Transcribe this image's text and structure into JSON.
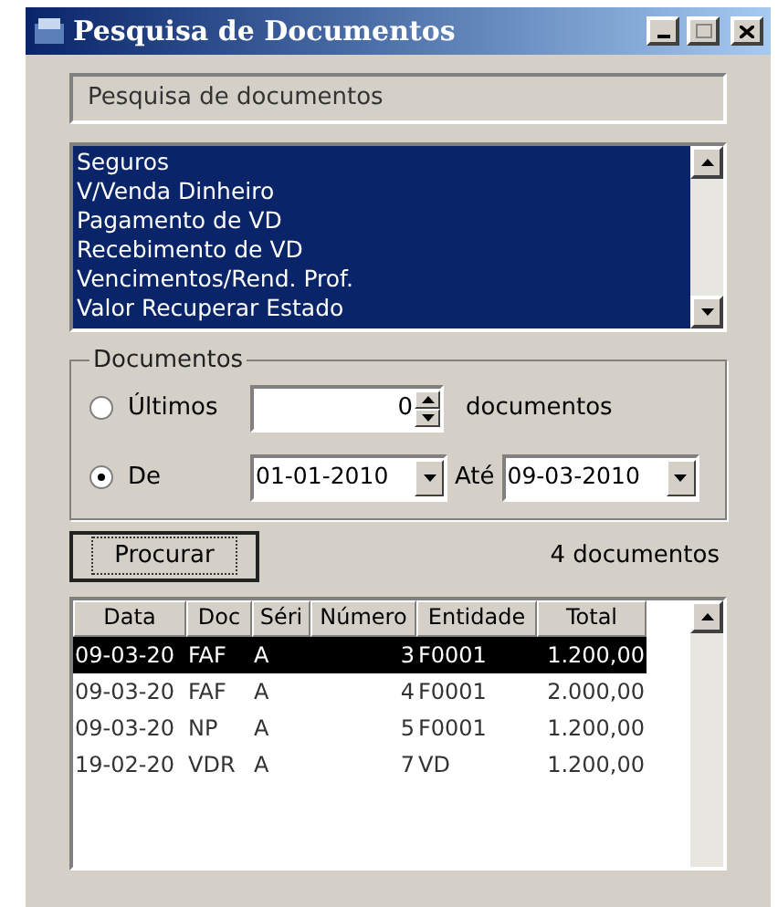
{
  "window": {
    "title": "Pesquisa de Documentos"
  },
  "header": "Pesquisa de documentos",
  "types": [
    {
      "label": "Seguros",
      "selected": true
    },
    {
      "label": "V/Venda Dinheiro",
      "selected": true
    },
    {
      "label": "Pagamento de VD",
      "selected": true
    },
    {
      "label": "Recebimento de VD",
      "selected": true
    },
    {
      "label": "Vencimentos/Rend. Prof.",
      "selected": true
    },
    {
      "label": "Valor Recuperar Estado",
      "selected": true
    }
  ],
  "documents": {
    "legend": "Documentos",
    "options": [
      {
        "label": "Últimos",
        "selected": false
      },
      {
        "label": "De",
        "selected": true
      }
    ],
    "count_value": "0",
    "count_suffix": "documentos",
    "from_date": "01-01-2010",
    "to_label": "Até",
    "to_date": "09-03-2010"
  },
  "search_button": "Procurar",
  "result_count": "4 documentos",
  "table": {
    "columns": [
      "Data",
      "Doc",
      "Séri",
      "Número",
      "Entidade",
      "Total"
    ],
    "rows": [
      {
        "cells": [
          "09-03-20",
          "FAF",
          "A",
          "3",
          "F0001",
          "1.200,00"
        ],
        "selected": true
      },
      {
        "cells": [
          "09-03-20",
          "FAF",
          "A",
          "4",
          "F0001",
          "2.000,00"
        ],
        "selected": false
      },
      {
        "cells": [
          "09-03-20",
          "NP",
          "A",
          "5",
          "F0001",
          "1.200,00"
        ],
        "selected": false
      },
      {
        "cells": [
          "19-02-20",
          "VDR",
          "A",
          "7",
          "VD",
          "1.200,00"
        ],
        "selected": false
      }
    ]
  }
}
